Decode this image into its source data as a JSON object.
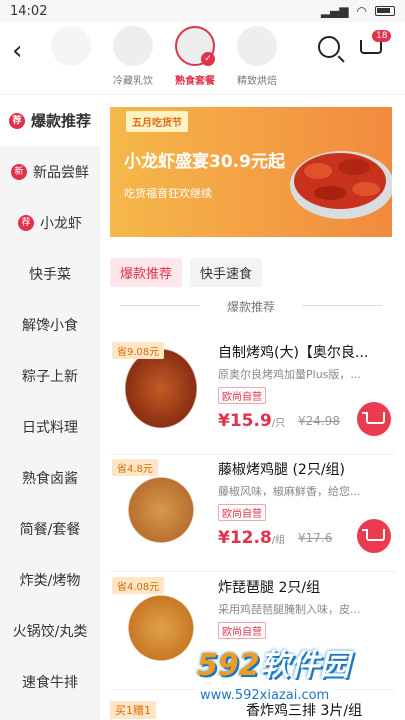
{
  "status": {
    "time": "14:02",
    "battery_level": 0.7
  },
  "header": {
    "categories": [
      {
        "label": "冷藏乳饮",
        "active": false
      },
      {
        "label": "熟食套餐",
        "active": true
      },
      {
        "label": "精致烘焙",
        "active": false
      }
    ],
    "cart_count": "18",
    "icons": [
      "back-icon",
      "search-icon",
      "cart-icon"
    ]
  },
  "sidebar": {
    "items": [
      {
        "label": "爆款推荐",
        "tag": "荐",
        "active": true
      },
      {
        "label": "新品尝鲜",
        "tag": "新",
        "active": false
      },
      {
        "label": "小龙虾",
        "tag": "荐",
        "active": false
      },
      {
        "label": "快手菜",
        "tag": "",
        "active": false
      },
      {
        "label": "解馋小食",
        "tag": "",
        "active": false
      },
      {
        "label": "粽子上新",
        "tag": "",
        "active": false
      },
      {
        "label": "日式料理",
        "tag": "",
        "active": false
      },
      {
        "label": "熟食卤酱",
        "tag": "",
        "active": false
      },
      {
        "label": "简餐/套餐",
        "tag": "",
        "active": false
      },
      {
        "label": "炸类/烤物",
        "tag": "",
        "active": false
      },
      {
        "label": "火锅饺/丸类",
        "tag": "",
        "active": false
      },
      {
        "label": "速食牛排",
        "tag": "",
        "active": false
      }
    ]
  },
  "banner": {
    "tag": "五月吃货节",
    "title": "小龙虾盛宴30.9元起",
    "subtitle": "吃货福音狂欢继续"
  },
  "tabs": [
    {
      "label": "爆款推荐",
      "active": true
    },
    {
      "label": "快手速食",
      "active": false
    }
  ],
  "section_title": "爆款推荐",
  "products": [
    {
      "save": "省9.08元",
      "name": "自制烤鸡(大)【奥尔良...",
      "desc": "原奥尔良烤鸡加量Plus版，...",
      "shop": "欧尚自营",
      "price": "¥15.9",
      "unit": "/只",
      "original": "¥24.98"
    },
    {
      "save": "省4.8元",
      "name": "藤椒烤鸡腿 (2只/组)",
      "desc": "藤椒风味，椒麻鲜香，给您...",
      "shop": "欧尚自营",
      "price": "¥12.8",
      "unit": "/组",
      "original": "¥17.6"
    },
    {
      "save": "省4.08元",
      "name": "炸琵琶腿 2只/组",
      "desc": "采用鸡琵琶腿腌制入味，皮...",
      "shop": "欧尚自营",
      "price": "",
      "unit": "",
      "original": ""
    }
  ],
  "bottom_peek": {
    "tag": "买1赠1",
    "name": "香炸鸡三排 3片/组"
  },
  "watermark": {
    "brand_num": "592",
    "brand_text": "软件园",
    "url": "www.592xiazai.com"
  }
}
